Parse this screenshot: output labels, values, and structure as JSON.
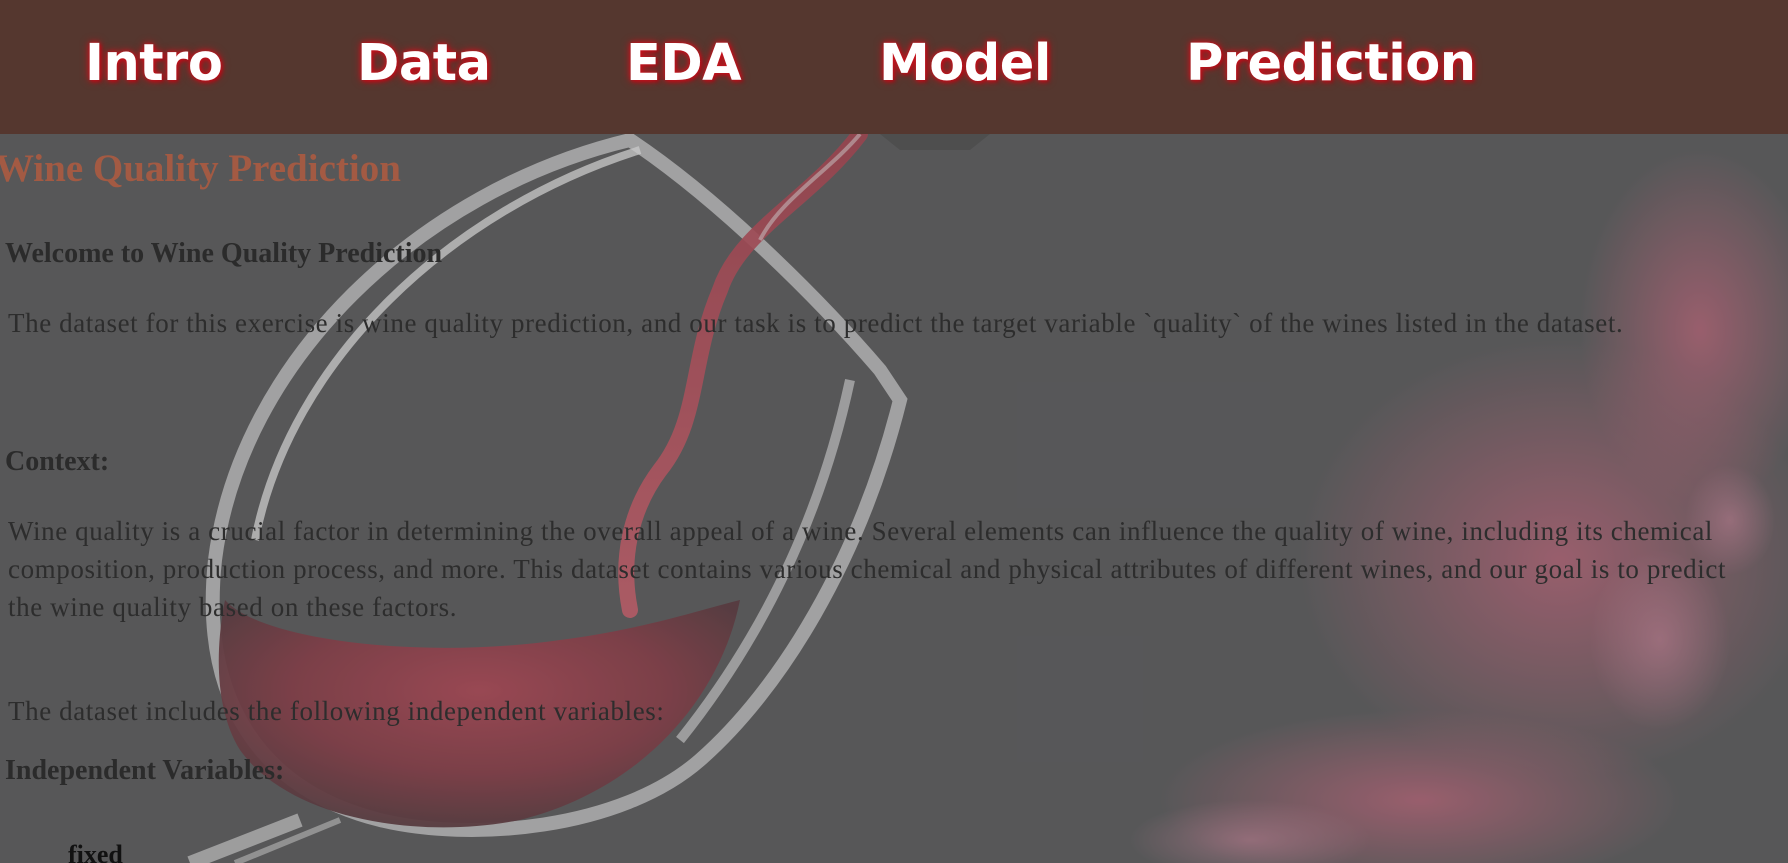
{
  "nav": {
    "items": [
      {
        "label": "Intro"
      },
      {
        "label": "Data"
      },
      {
        "label": "EDA"
      },
      {
        "label": "Model"
      },
      {
        "label": "Prediction"
      }
    ],
    "background": "#55372f",
    "text_color": "#ffffff",
    "glow_color": "#c8141e"
  },
  "main": {
    "title": "Wine Quality Prediction",
    "welcome_heading": "Welcome to Wine Quality Prediction",
    "intro_paragraph": "The dataset for this exercise is wine quality prediction, and our task is to predict the target variable `quality` of the wines listed in the dataset.",
    "context_heading": "Context:",
    "context_paragraph": "Wine quality is a crucial factor in determining the overall appeal of a wine. Several elements can influence the quality of wine, including its chemical composition, production process, and more. This dataset contains various chemical and physical attributes of different wines, and our goal is to predict the wine quality based on these factors.",
    "variables_intro": "The dataset includes the following independent variables:",
    "variables_heading": "Independent Variables:",
    "variables": [
      "fixed"
    ]
  },
  "background_image": {
    "icon": "wine-glass-pour-image",
    "tint": "#7f7f7f"
  }
}
